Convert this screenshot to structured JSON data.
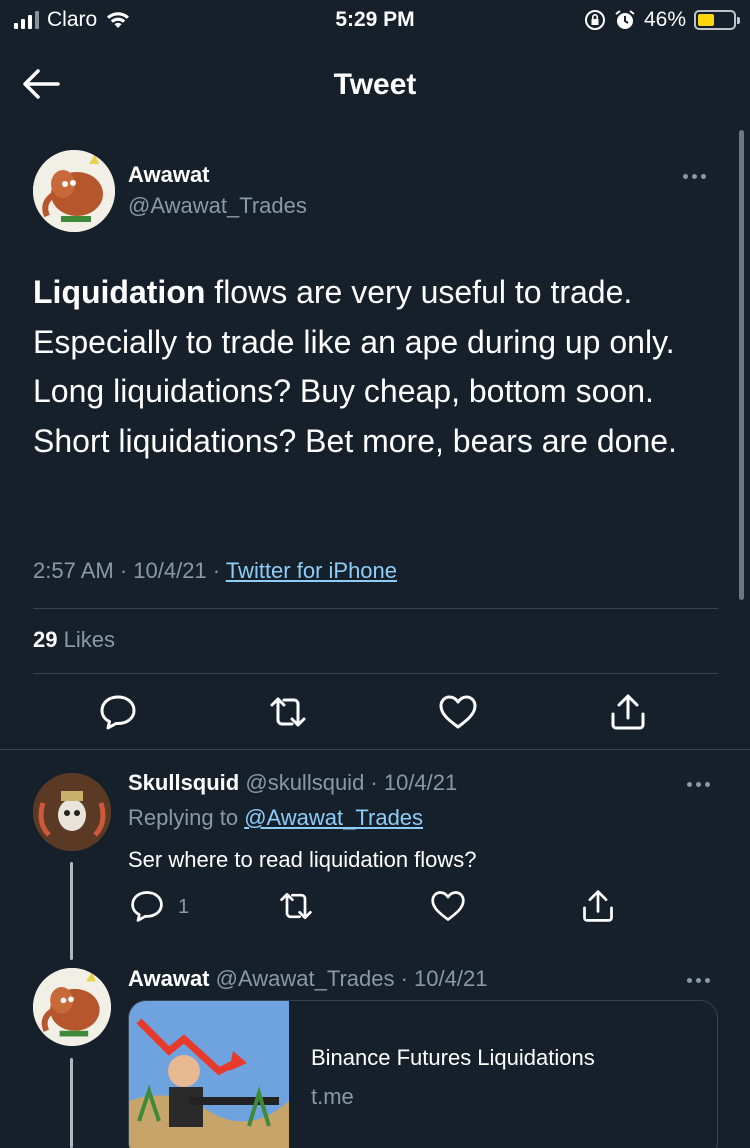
{
  "status_bar": {
    "carrier": "Claro",
    "time": "5:29 PM",
    "battery": "46%"
  },
  "header": {
    "title": "Tweet"
  },
  "main_tweet": {
    "name": "Awawat",
    "handle": "@Awawat_Trades",
    "text_bold": "Liquidation",
    "text_rest": " flows are very useful to trade. Especially to trade like an ape during up only. Long liquidations? Buy cheap, bottom soon. Short liquidations? Bet more, bears are done.",
    "time": "2:57 AM · 10/4/21 · ",
    "source": "Twitter for iPhone",
    "likes_count": "29",
    "likes_label": " Likes"
  },
  "reply1": {
    "name": "Skullsquid",
    "handle_date": " @skullsquid · 10/4/21",
    "replying_prefix": "Replying to ",
    "replying_to": "@Awawat_Trades",
    "text": "Ser where to read liquidation flows?",
    "reply_count": "1"
  },
  "reply2": {
    "name": "Awawat",
    "handle_date": " @Awawat_Trades · 10/4/21",
    "card_title": "Binance Futures Liquidations",
    "card_domain": "t.me"
  },
  "colors": {
    "background": "#15202b",
    "secondary_text": "#8b98a5",
    "link": "#8ecdf8",
    "divider": "#38444d"
  }
}
